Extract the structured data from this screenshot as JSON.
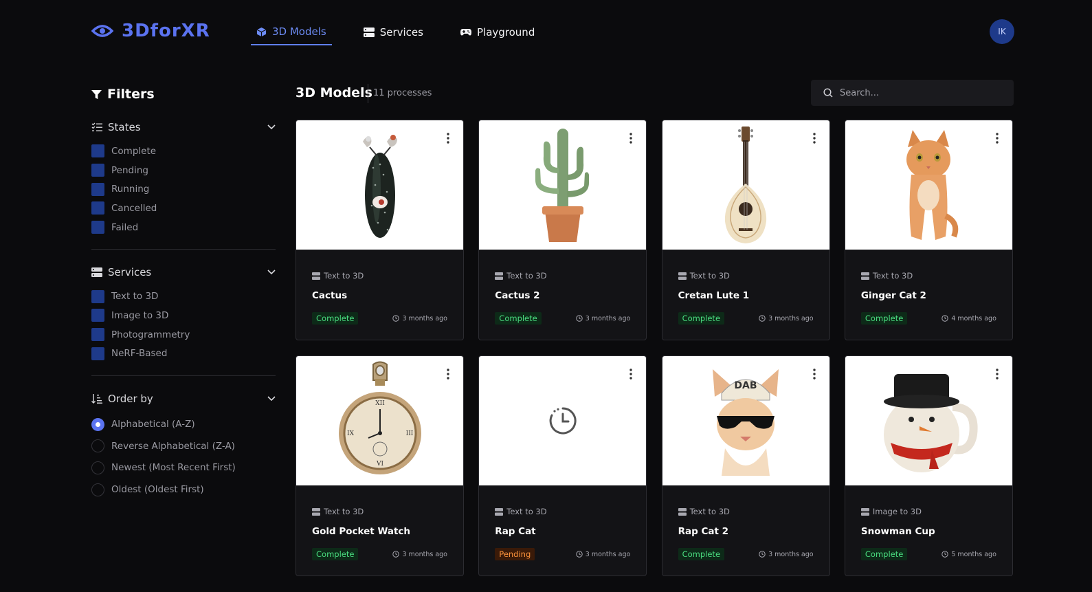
{
  "brand": {
    "name": "3DforXR",
    "color": "#5b73f0"
  },
  "nav": [
    {
      "label": "3D Models",
      "icon": "cube-icon",
      "active": true
    },
    {
      "label": "Services",
      "icon": "server-icon",
      "active": false
    },
    {
      "label": "Playground",
      "icon": "gamepad-icon",
      "active": false
    }
  ],
  "user": {
    "initials": "IK"
  },
  "filters": {
    "title": "Filters",
    "states": {
      "title": "States",
      "options": [
        "Complete",
        "Pending",
        "Running",
        "Cancelled",
        "Failed"
      ]
    },
    "services": {
      "title": "Services",
      "options": [
        "Text to 3D",
        "Image to 3D",
        "Photogrammetry",
        "NeRF-Based"
      ]
    },
    "order": {
      "title": "Order by",
      "options": [
        "Alphabetical (A-Z)",
        "Reverse Alphabetical (Z-A)",
        "Newest (Most Recent First)",
        "Oldest (Oldest First)"
      ],
      "selected": 0
    }
  },
  "main": {
    "title": "3D Models",
    "count": "11 processes",
    "search_placeholder": "Search..."
  },
  "cards": [
    {
      "service": "Text to 3D",
      "name": "Cactus",
      "status": "Complete",
      "time": "3 months ago",
      "image": "cactus-bird"
    },
    {
      "service": "Text to 3D",
      "name": "Cactus 2",
      "status": "Complete",
      "time": "3 months ago",
      "image": "potted-cactus"
    },
    {
      "service": "Text to 3D",
      "name": "Cretan Lute 1",
      "status": "Complete",
      "time": "3 months ago",
      "image": "lute"
    },
    {
      "service": "Text to 3D",
      "name": "Ginger Cat 2",
      "status": "Complete",
      "time": "4 months ago",
      "image": "ginger-cat"
    },
    {
      "service": "Text to 3D",
      "name": "Gold Pocket Watch",
      "status": "Complete",
      "time": "3 months ago",
      "image": "pocket-watch"
    },
    {
      "service": "Text to 3D",
      "name": "Rap Cat",
      "status": "Pending",
      "time": "3 months ago",
      "image": "pending-clock"
    },
    {
      "service": "Text to 3D",
      "name": "Rap Cat 2",
      "status": "Complete",
      "time": "3 months ago",
      "image": "rap-cat",
      "cap_text": "DAB"
    },
    {
      "service": "Image to 3D",
      "name": "Snowman Cup",
      "status": "Complete",
      "time": "5 months ago",
      "image": "snowman-cup"
    }
  ]
}
